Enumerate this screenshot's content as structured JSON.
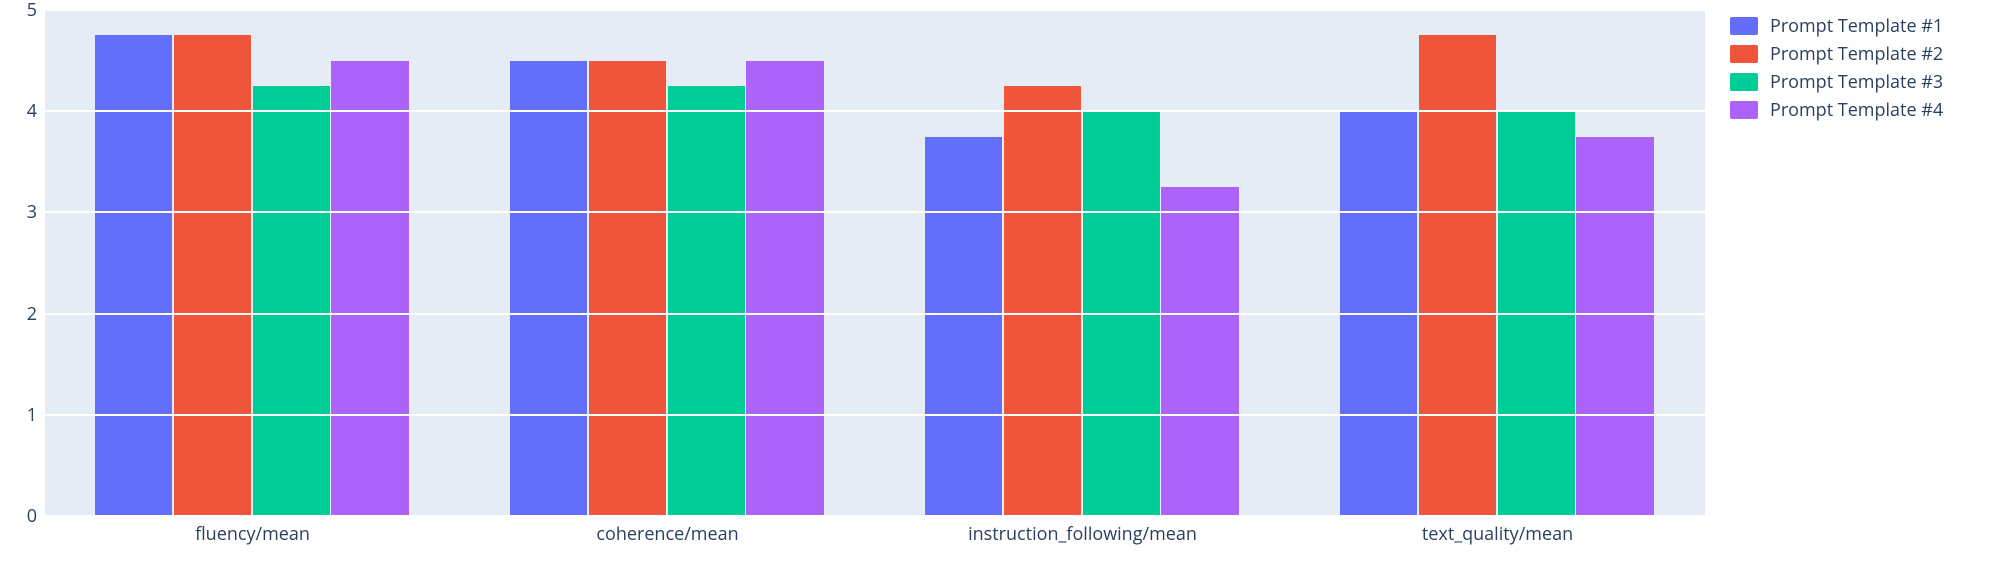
{
  "chart_data": {
    "type": "bar",
    "categories": [
      "fluency/mean",
      "coherence/mean",
      "instruction_following/mean",
      "text_quality/mean"
    ],
    "series": [
      {
        "name": "Prompt Template #1",
        "color": "#636efa",
        "values": [
          4.75,
          4.5,
          3.75,
          4.0
        ]
      },
      {
        "name": "Prompt Template #2",
        "color": "#ef553b",
        "values": [
          4.75,
          4.5,
          4.25,
          4.75
        ]
      },
      {
        "name": "Prompt Template #3",
        "color": "#00cc96",
        "values": [
          4.25,
          4.25,
          4.0,
          4.0
        ]
      },
      {
        "name": "Prompt Template #4",
        "color": "#ab63fa",
        "values": [
          4.5,
          4.5,
          3.25,
          3.75
        ]
      }
    ],
    "ylim": [
      0,
      5
    ],
    "yticks": [
      0,
      1,
      2,
      3,
      4,
      5
    ],
    "title": "",
    "xlabel": "",
    "ylabel": ""
  }
}
